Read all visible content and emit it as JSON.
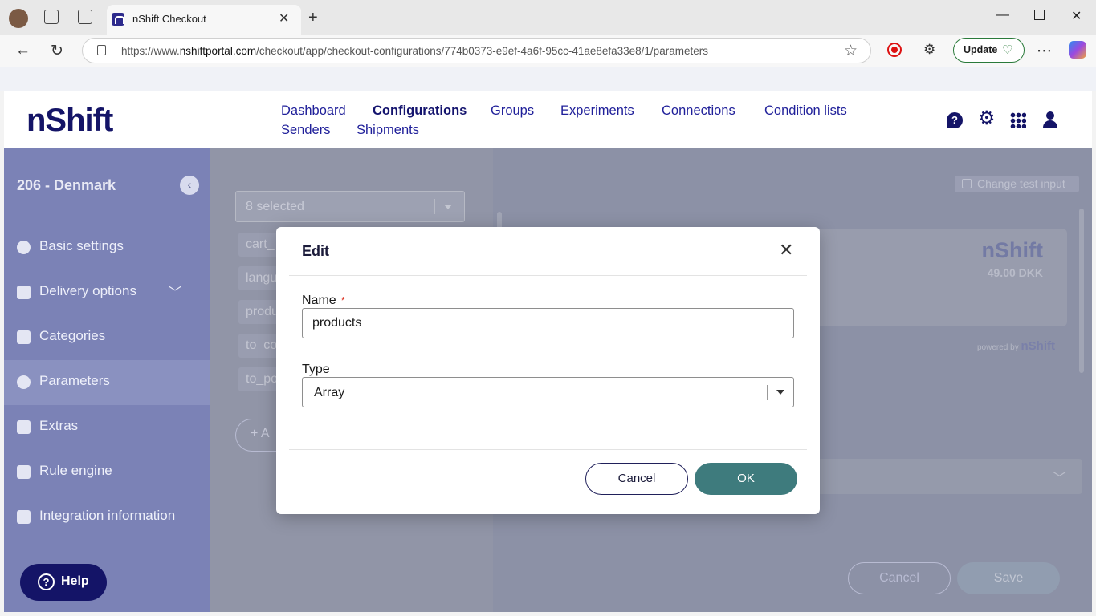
{
  "browser": {
    "tab_title": "nShift Checkout",
    "url_prefix": "https://www.",
    "url_domain": "nshiftportal.com",
    "url_path": "/checkout/app/checkout-configurations/774b0373-e9ef-4a6f-95cc-41ae8efa33e8/1/parameters",
    "update_label": "Update"
  },
  "header": {
    "logo": "nShift",
    "nav": [
      "Dashboard",
      "Configurations",
      "Groups",
      "Experiments",
      "Connections",
      "Condition lists",
      "Senders",
      "Shipments"
    ],
    "active_nav": "Configurations"
  },
  "sidebar": {
    "title": "206 - Denmark",
    "items": [
      {
        "label": "Basic settings",
        "icon": "gear-icon"
      },
      {
        "label": "Delivery options",
        "icon": "truck-icon"
      },
      {
        "label": "Categories",
        "icon": "list-icon"
      },
      {
        "label": "Parameters",
        "icon": "code-icon"
      },
      {
        "label": "Extras",
        "icon": "box-icon"
      },
      {
        "label": "Rule engine",
        "icon": "rule-icon"
      },
      {
        "label": "Integration information",
        "icon": "document-icon"
      }
    ],
    "selected": "Parameters",
    "help_label": "Help"
  },
  "main": {
    "filter_value": "8 selected",
    "params": [
      "cart_",
      "langu",
      "produ",
      "to_co",
      "to_po"
    ],
    "add_label": "A",
    "change_test_input": "Change test input",
    "preview_logo": "nShift",
    "preview_price": "49.00 DKK",
    "powered_by": "powered by",
    "powered_logo": "nShift",
    "cancel_label": "Cancel",
    "save_label": "Save"
  },
  "modal": {
    "title": "Edit",
    "name_label": "Name",
    "name_value": "products",
    "type_label": "Type",
    "type_value": "Array",
    "cancel_label": "Cancel",
    "ok_label": "OK"
  },
  "colors": {
    "brand": "#141467",
    "ok_button": "#3e7b7d",
    "required": "#dd3322"
  }
}
